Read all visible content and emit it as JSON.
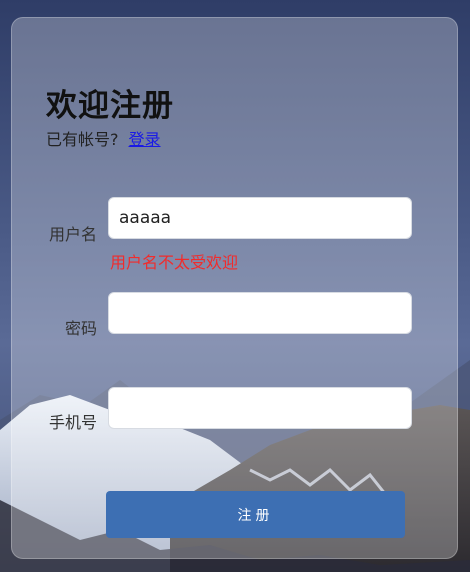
{
  "form": {
    "title": "欢迎注册",
    "login_prompt": "已有帐号?",
    "login_link": "登录",
    "fields": [
      {
        "label": "用户名",
        "value": "aaaaa",
        "placeholder": ""
      },
      {
        "label": "密码",
        "value": "",
        "placeholder": ""
      },
      {
        "label": "手机号",
        "value": "",
        "placeholder": ""
      }
    ],
    "username_error": "用户名不太受欢迎",
    "submit_label": "注册"
  },
  "colors": {
    "accent": "#3d6fb3",
    "error": "#f22b2b",
    "link": "#1a1ae6"
  }
}
